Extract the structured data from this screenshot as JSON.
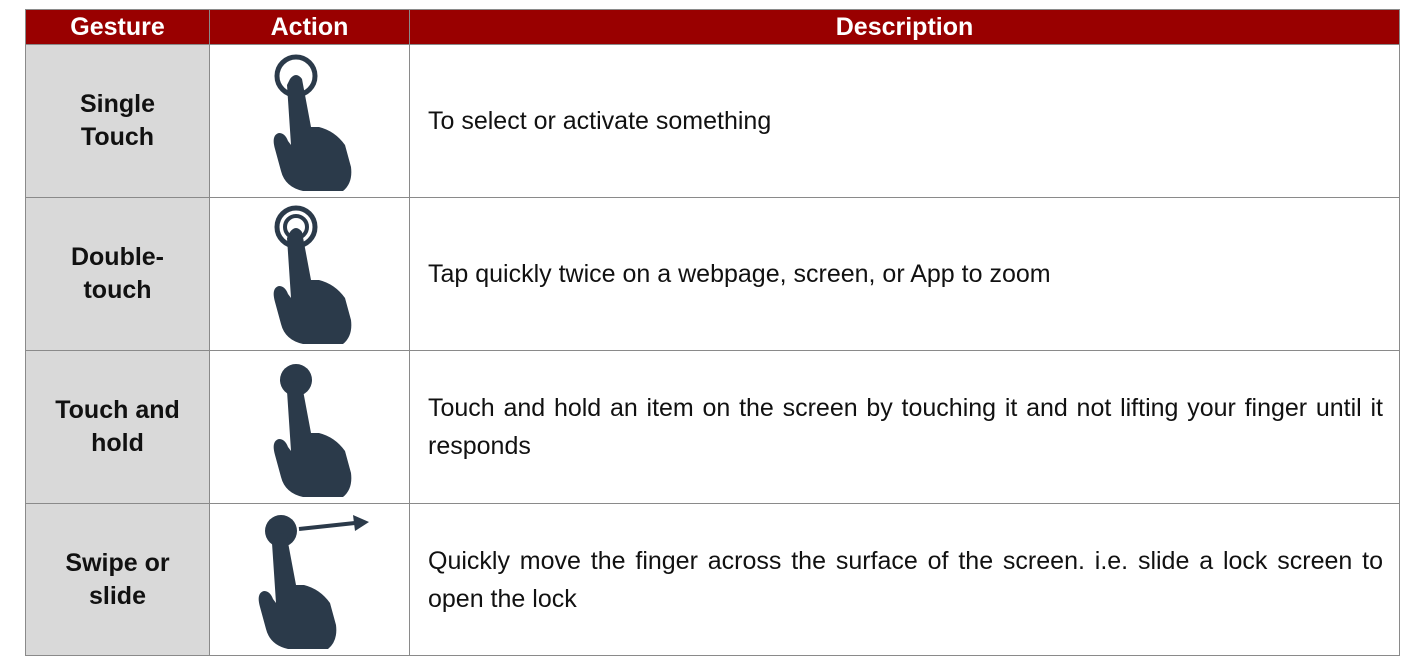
{
  "table": {
    "headers": [
      "Gesture",
      "Action",
      "Description"
    ],
    "rows": [
      {
        "gesture": "Single\nTouch",
        "icon": "single-touch-icon",
        "description": "To select or activate something"
      },
      {
        "gesture": "Double-\ntouch",
        "icon": "double-touch-icon",
        "description": "Tap quickly twice on a webpage, screen, or App to zoom"
      },
      {
        "gesture": "Touch and\nhold",
        "icon": "touch-and-hold-icon",
        "description": "Touch and hold an item on the screen by touching it and not lifting your finger until it responds"
      },
      {
        "gesture": "Swipe or\nslide",
        "icon": "swipe-icon",
        "description": "Quickly move the finger across the surface of the screen. i.e. slide a lock screen to open the lock"
      }
    ]
  },
  "colors": {
    "header_bg": "#990000",
    "header_text": "#ffffff",
    "gesture_cell_bg": "#d9d9d9",
    "hand_icon": "#2b3a4a"
  }
}
